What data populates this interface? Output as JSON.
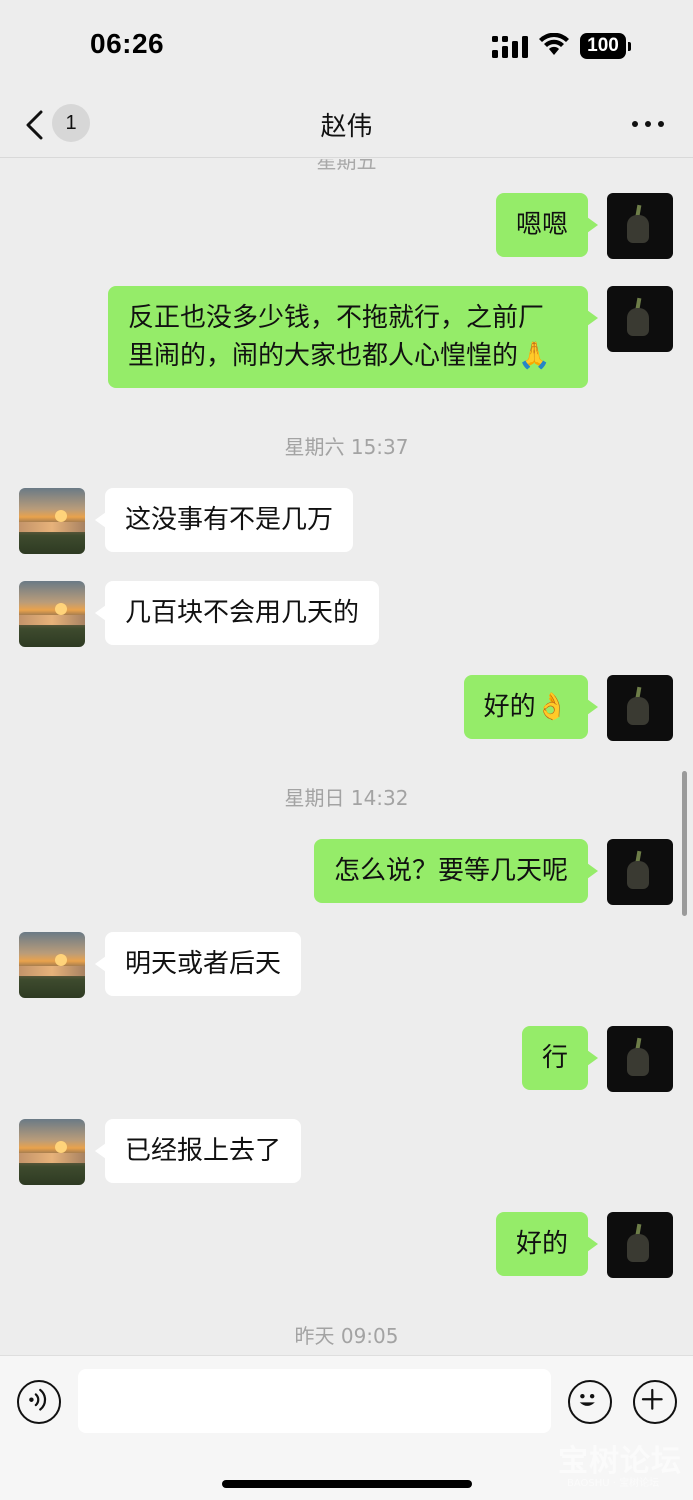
{
  "status_bar": {
    "time": "06:26",
    "battery": "100",
    "icons": [
      "signal-icon",
      "wifi-icon",
      "battery-icon"
    ]
  },
  "nav": {
    "unread_count": "1",
    "title": "赵伟",
    "back_icon": "chevron-left-icon",
    "more_icon": "more-dots-icon"
  },
  "chat": {
    "partial_timestamp": "星期五",
    "timestamps": [
      "星期六 15:37",
      "星期日 14:32",
      "昨天 09:05"
    ],
    "messages": [
      {
        "sender": "self",
        "text": "嗯嗯"
      },
      {
        "sender": "self",
        "text": "反正也没多少钱，不拖就行，之前厂里闹的，闹的大家也都人心惶惶的🙏"
      },
      {
        "sender": "other",
        "text": "这没事有不是几万"
      },
      {
        "sender": "other",
        "text": "几百块不会用几天的"
      },
      {
        "sender": "self",
        "text": "好的👌"
      },
      {
        "sender": "self",
        "text": "怎么说？要等几天呢"
      },
      {
        "sender": "other",
        "text": "明天或者后天"
      },
      {
        "sender": "self",
        "text": "行"
      },
      {
        "sender": "other",
        "text": "已经报上去了"
      },
      {
        "sender": "self",
        "text": "好的"
      }
    ]
  },
  "input_bar": {
    "placeholder": "",
    "voice_icon": "voice-icon",
    "emoji_icon": "emoji-icon",
    "plus_icon": "plus-icon"
  },
  "watermark": {
    "text": "宝树论坛",
    "sub": "BAOSHU · 宝树论坛"
  },
  "colors": {
    "background": "#ededed",
    "self_bubble": "#95ec69",
    "other_bubble": "#ffffff",
    "timestamp": "#a3a3a3"
  }
}
